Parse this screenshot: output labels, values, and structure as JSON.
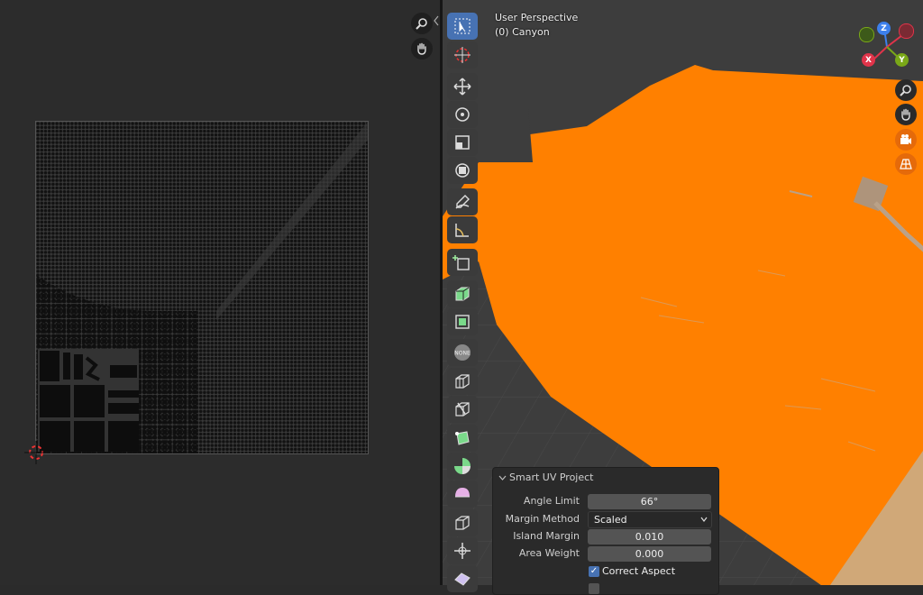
{
  "viewport": {
    "mode": "User Perspective",
    "object": "(0) Canyon",
    "gizmo": {
      "x": "X",
      "y": "Y",
      "z": "Z"
    }
  },
  "uv_editor": {
    "nav_icons": [
      "zoom-icon",
      "hand-pan-icon"
    ]
  },
  "toolbar": {
    "tools": [
      "select-box",
      "cursor",
      "move",
      "rotate",
      "scale",
      "transform",
      "annotate",
      "measure",
      "add-cube",
      "extrude-region",
      "inset-faces",
      "bevel",
      "loop-cut",
      "knife",
      "poly-build",
      "spin",
      "smooth",
      "edge-slide",
      "shrink-fatten"
    ],
    "none_badge": "NONE"
  },
  "operator_panel": {
    "title": "Smart UV Project",
    "angle_limit_label": "Angle Limit",
    "angle_limit_value": "66°",
    "margin_method_label": "Margin Method",
    "margin_method_value": "Scaled",
    "island_margin_label": "Island Margin",
    "island_margin_value": "0.010",
    "area_weight_label": "Area Weight",
    "area_weight_value": "0.000",
    "correct_aspect_label": "Correct Aspect",
    "correct_aspect_checked": true
  },
  "colors": {
    "selection_orange": "#ff8000",
    "active_blue": "#4772b3",
    "x_axis": "#e0344a",
    "y_axis": "#7aa818",
    "z_axis": "#3d80ec"
  }
}
